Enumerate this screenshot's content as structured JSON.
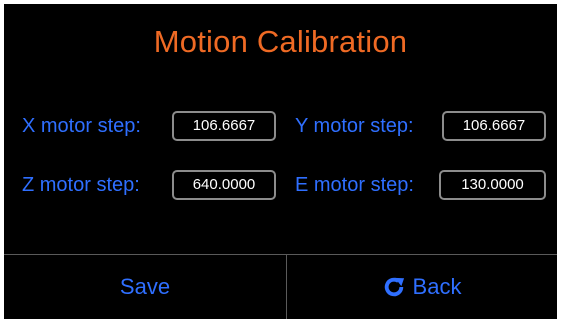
{
  "title": "Motion Calibration",
  "colors": {
    "title": "#ef6a24",
    "label": "#2f6fff",
    "background": "#000000",
    "field_border": "#8c8c8c",
    "value_text": "#ffffff"
  },
  "fields": {
    "x": {
      "label": "X motor step:",
      "value": "106.6667"
    },
    "y": {
      "label": "Y motor step:",
      "value": "106.6667"
    },
    "z": {
      "label": "Z motor step:",
      "value": "640.0000"
    },
    "e": {
      "label": "E motor step:",
      "value": "130.0000"
    }
  },
  "buttons": {
    "save_label": "Save",
    "back_label": "Back",
    "back_icon": "refresh-icon"
  }
}
